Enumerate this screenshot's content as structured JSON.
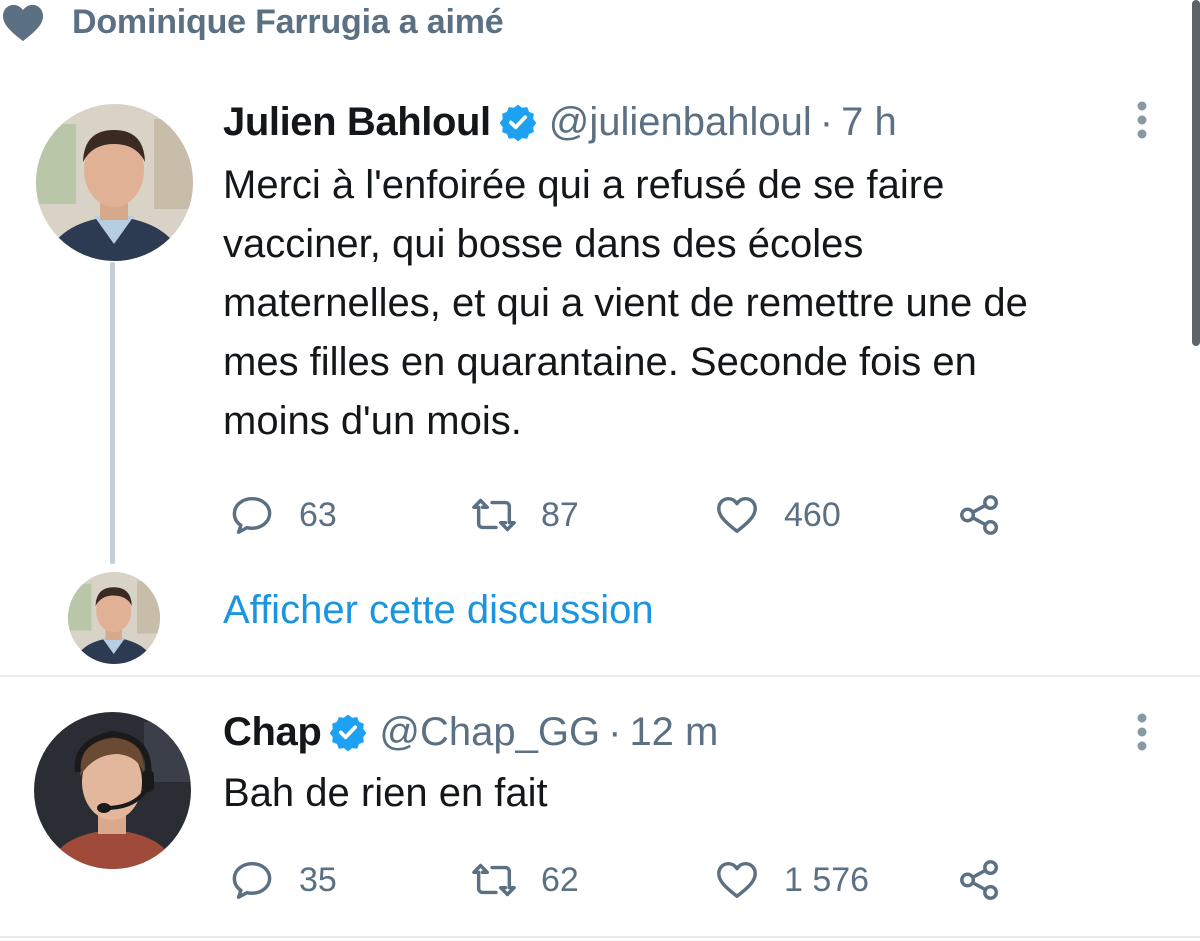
{
  "social_context": {
    "text": "Dominique Farrugia a aimé",
    "icon": "heart-icon"
  },
  "tweets": [
    {
      "author": {
        "name": "Julien Bahloul",
        "handle": "@julienbahloul",
        "verified": true
      },
      "time": "7 h",
      "text": "Merci à l'enfoirée qui a refusé de se faire\nvacciner, qui bosse dans des écoles\nmaternelles, et qui a vient de remettre une de\nmes filles en quarantaine. Seconde fois en\nmoins d'un mois.",
      "counts": {
        "replies": "63",
        "retweets": "87",
        "likes": "460"
      }
    },
    {
      "author": {
        "name": "Chap",
        "handle": "@Chap_GG",
        "verified": true
      },
      "time": "12 m",
      "text": "Bah de rien en fait",
      "counts": {
        "replies": "35",
        "retweets": "62",
        "likes": "1 576"
      }
    }
  ],
  "show_thread": {
    "label": "Afficher cette discussion"
  },
  "separator": "·",
  "colors": {
    "text_primary": "#14171a",
    "text_secondary": "#5b7083",
    "link": "#1b95e0",
    "verified": "#1da1f2",
    "thread_line": "#c4cfd6"
  }
}
